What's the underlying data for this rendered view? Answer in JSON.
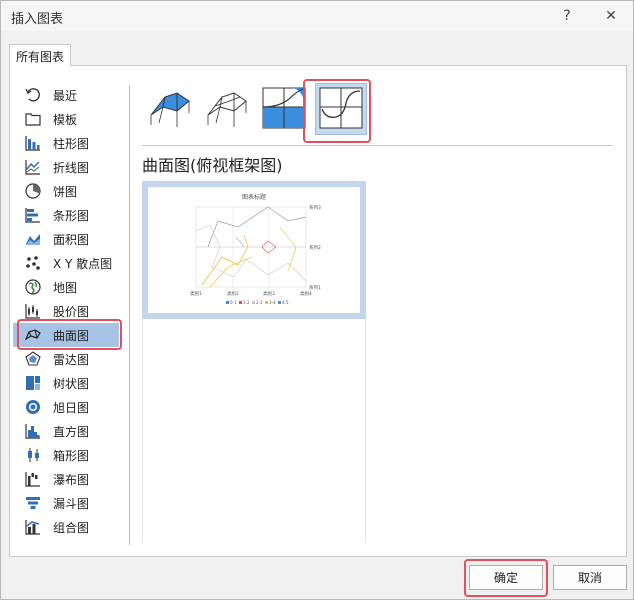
{
  "dialog": {
    "title": "插入图表",
    "help": "?",
    "close": "✕"
  },
  "tabs": [
    {
      "label": "所有图表"
    }
  ],
  "sidebar": {
    "items": [
      {
        "label": "最近"
      },
      {
        "label": "模板"
      },
      {
        "label": "柱形图"
      },
      {
        "label": "折线图"
      },
      {
        "label": "饼图"
      },
      {
        "label": "条形图"
      },
      {
        "label": "面积图"
      },
      {
        "label": "X Y 散点图"
      },
      {
        "label": "地图"
      },
      {
        "label": "股价图"
      },
      {
        "label": "曲面图"
      },
      {
        "label": "雷达图"
      },
      {
        "label": "树状图"
      },
      {
        "label": "旭日图"
      },
      {
        "label": "直方图"
      },
      {
        "label": "箱形图"
      },
      {
        "label": "瀑布图"
      },
      {
        "label": "漏斗图"
      },
      {
        "label": "组合图"
      }
    ],
    "selected": "曲面图"
  },
  "chart_types": {
    "selected": "曲面图(俯视框架图)",
    "icons": [
      "3d-surface-icon",
      "wireframe-3d-surface-icon",
      "contour-icon",
      "wireframe-contour-icon"
    ]
  },
  "preview": {
    "title": "图表标题",
    "right_labels": [
      "系列3",
      "系列2",
      "系列1"
    ],
    "x_labels": [
      "类别1",
      "类别2",
      "类别3",
      "类别4"
    ],
    "legend": [
      "0-1",
      "1-2",
      "2-3",
      "3-4",
      "4-5"
    ]
  },
  "buttons": {
    "ok": "确定",
    "cancel": "取消"
  },
  "colors": {
    "accent": "#4a90d9",
    "selection": "#a8c4e5",
    "highlight": "#e0505e"
  }
}
